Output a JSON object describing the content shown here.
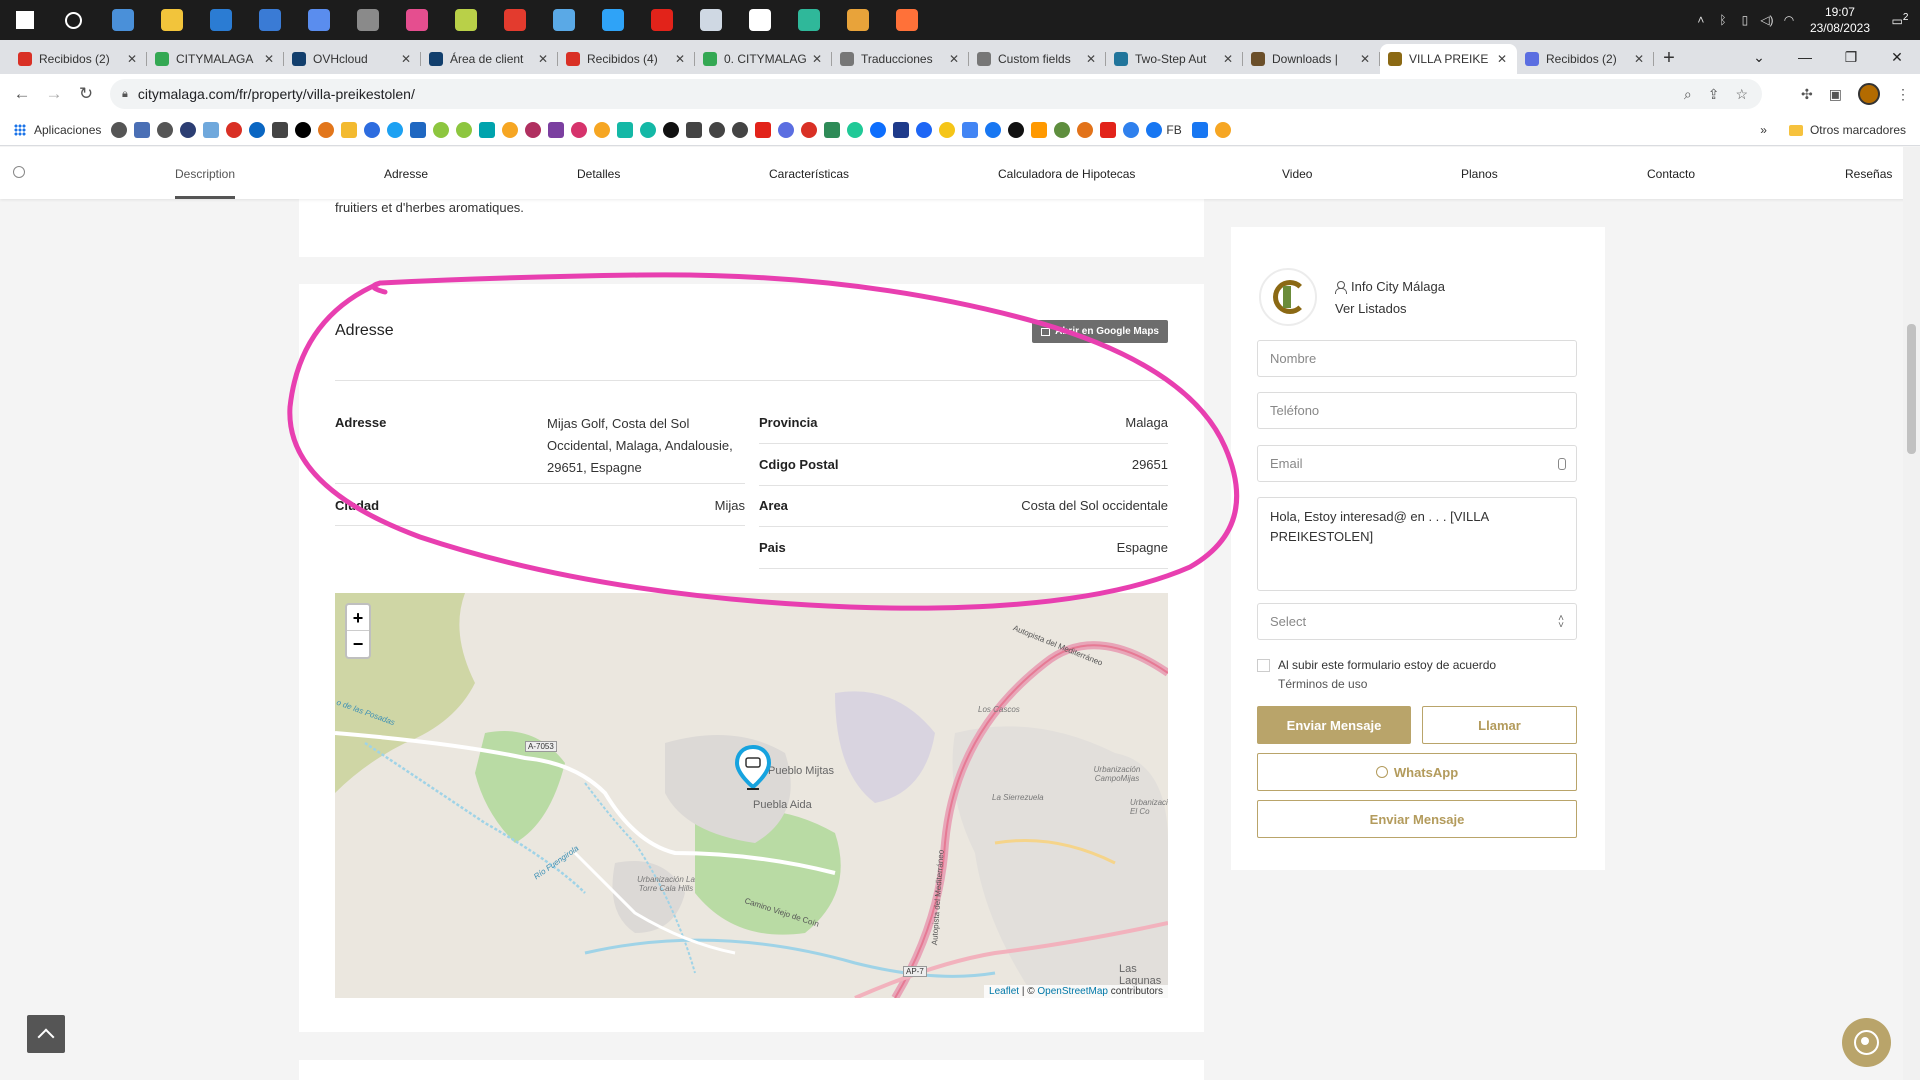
{
  "taskbar": {
    "time": "19:07",
    "date": "23/08/2023",
    "notification_count": "2",
    "apps": [
      {
        "name": "start-icon",
        "color": "#ffffff"
      },
      {
        "name": "search-icon",
        "color": "#ffffff"
      },
      {
        "name": "task-view-icon",
        "color": "#4a90d9"
      },
      {
        "name": "file-explorer-icon",
        "color": "#f2c43b"
      },
      {
        "name": "mail-icon",
        "color": "#2b7cd3"
      },
      {
        "name": "store-icon",
        "color": "#3a7bd5"
      },
      {
        "name": "edge-dev-icon",
        "color": "#5a8dee"
      },
      {
        "name": "calculator-icon",
        "color": "#8a8a8a"
      },
      {
        "name": "app-rings-icon",
        "color": "#e54e8f"
      },
      {
        "name": "app-green-icon",
        "color": "#b9d048"
      },
      {
        "name": "app-cypher-icon",
        "color": "#e33b2e"
      },
      {
        "name": "notepad-icon",
        "color": "#5aa9e6"
      },
      {
        "name": "photoshop-icon",
        "color": "#2fa3f7"
      },
      {
        "name": "acrobat-icon",
        "color": "#e2231a"
      },
      {
        "name": "app-cube-icon",
        "color": "#cfd8e3"
      },
      {
        "name": "settings-icon",
        "color": "#ffffff"
      },
      {
        "name": "edge-icon",
        "color": "#2fb89a"
      },
      {
        "name": "chrome-icon",
        "color": "#e8a33a"
      },
      {
        "name": "firefox-icon",
        "color": "#ff7139"
      }
    ]
  },
  "tabs": [
    {
      "label": "Recibidos (2)",
      "color": "#d93025"
    },
    {
      "label": "CITYMALAGA",
      "color": "#34a853"
    },
    {
      "label": "OVHcloud",
      "color": "#123f6d"
    },
    {
      "label": "Área de client",
      "color": "#123f6d"
    },
    {
      "label": "Recibidos (4)",
      "color": "#d93025"
    },
    {
      "label": "0. CITYMALAG",
      "color": "#34a853"
    },
    {
      "label": "Traducciones",
      "color": "#777777"
    },
    {
      "label": "Custom fields",
      "color": "#777777"
    },
    {
      "label": "Two-Step Aut",
      "color": "#21759b"
    },
    {
      "label": "Downloads |",
      "color": "#6b4f2a"
    },
    {
      "label": "VILLA PREIKE",
      "color": "#8b6914",
      "active": true
    },
    {
      "label": "Recibidos (2)",
      "color": "#5b6ee1"
    }
  ],
  "address_bar": {
    "url": "citymalaga.com/fr/property/villa-preikestolen/"
  },
  "bookmarks": {
    "apps_label": "Aplicaciones",
    "fb_label": "FB",
    "other_label": "Otros marcadores",
    "icon_colors": [
      "#555555",
      "#4a6fb5",
      "#555555",
      "#2c3e73",
      "#6fa8dc",
      "#d93025",
      "#0a66c2",
      "#444444",
      "#000000",
      "#e2761b",
      "#f3ba2f",
      "#2d6cdf",
      "#1da1f2",
      "#1f67c1",
      "#8dc63f",
      "#8dc63f",
      "#00a3ad",
      "#f6a623",
      "#b03060",
      "#7b3fa0",
      "#d6336c",
      "#f6a623",
      "#14b8a6",
      "#14b8a6",
      "#111111",
      "#444444",
      "#444444",
      "#444444",
      "#e2231a",
      "#5b6ee1",
      "#d93025",
      "#2e8b57",
      "#20c997",
      "#0d6efd",
      "#1e3a8a",
      "#1e66f5",
      "#f5c518",
      "#4285f4",
      "#1877f2",
      "#111111",
      "#ff9900",
      "#5e8e3e",
      "#e2731a",
      "#e2231a",
      "#2f80ed",
      "#1877f2",
      "#1877f2",
      "#f6a623"
    ]
  },
  "subnav": {
    "items": [
      "Description",
      "Adresse",
      "Detalles",
      "Características",
      "Calculadora de Hipotecas",
      "Video",
      "Planos",
      "Contacto",
      "Reseñas"
    ]
  },
  "description": {
    "tail_text": "fruitiers et d'herbes aromatiques."
  },
  "address_section": {
    "title": "Adresse",
    "google_maps_button": "Abrir en Google Maps",
    "left": [
      {
        "label": "Adresse",
        "value": "Mijas Golf, Costa del Sol Occidental, Malaga, Andalousie, 29651, Espagne"
      },
      {
        "label": "Ciudad",
        "value": "Mijas"
      }
    ],
    "right": [
      {
        "label": "Provincia",
        "value": "Malaga"
      },
      {
        "label": "Cdigo Postal",
        "value": "29651"
      },
      {
        "label": "Area",
        "value": "Costa del Sol occidentale"
      },
      {
        "label": "Pais",
        "value": "Espagne"
      }
    ]
  },
  "map": {
    "zoom_in": "+",
    "zoom_out": "−",
    "labels": {
      "autopista_top": "Autopista del Mediterráneo",
      "autopista_side": "Autopista del Mediterráneo",
      "a7053": "A-7053",
      "ap7": "AP-7",
      "pueblo": "Pueblo Mijtas",
      "puebla": "Puebla Aida",
      "los_cascos": "Los Cascos",
      "urb_campomijas": "Urbanización CampoMijas",
      "la_sierrezuela": "La Sierrezuela",
      "urb_el_co": "Urbanización El Co",
      "urb_torre": "Urbanización La Torre Cala Hills",
      "camino": "Camino Viejo de Coín",
      "rio": "Río Fuengirola",
      "posadas": "o de las Posadas",
      "lagunas": "Las Lagunas"
    },
    "attribution_leaflet": "Leaflet",
    "attribution_sep": " | © ",
    "attribution_osm": "OpenStreetMap",
    "attribution_contrib": " contributors"
  },
  "agent": {
    "name": "Info City Málaga",
    "listings_link": "Ver Listados"
  },
  "contact_form": {
    "name_placeholder": "Nombre",
    "phone_placeholder": "Teléfono",
    "email_placeholder": "Email",
    "message": "Hola, Estoy interesad@ en . . .  [VILLA PREIKESTOLEN]",
    "select_placeholder": "Select",
    "terms_text": "Al subir este formulario estoy de acuerdo",
    "terms_link": "Términos de uso",
    "send_button": "Enviar Mensaje",
    "call_button": "Llamar",
    "whatsapp_button": "WhatsApp",
    "send_button_2": "Enviar Mensaje"
  },
  "colors": {
    "accent": "#b9a46a",
    "annotation": "#e83fb0"
  }
}
